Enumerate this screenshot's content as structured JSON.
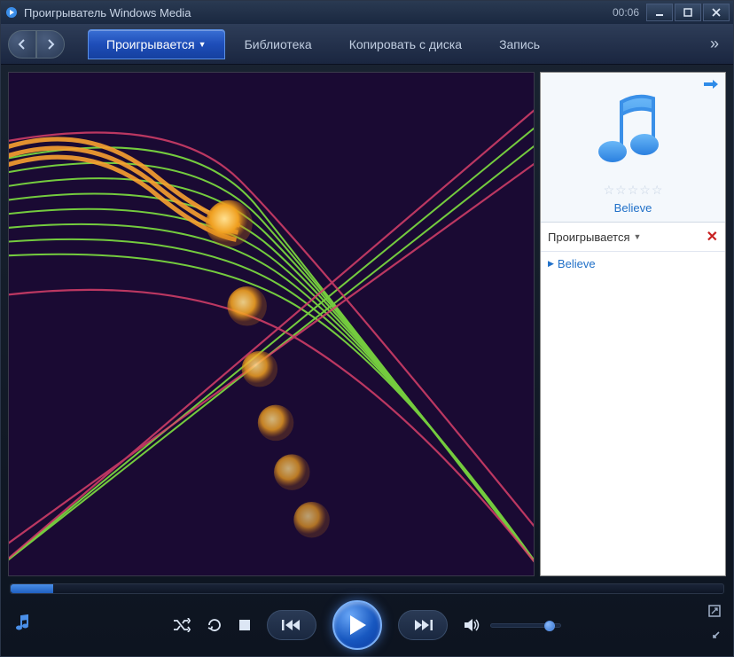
{
  "window": {
    "title": "Проигрыватель Windows Media",
    "time": "00:06"
  },
  "tabs": {
    "now_playing": "Проигрывается",
    "library": "Библиотека",
    "rip": "Копировать с диска",
    "burn": "Запись"
  },
  "sidebar": {
    "album_title": "Believe",
    "playlist_header": "Проигрывается",
    "items": [
      {
        "label": "Believe"
      }
    ]
  },
  "colors": {
    "accent": "#2e8be8",
    "tab_active": "#1e4db8"
  }
}
